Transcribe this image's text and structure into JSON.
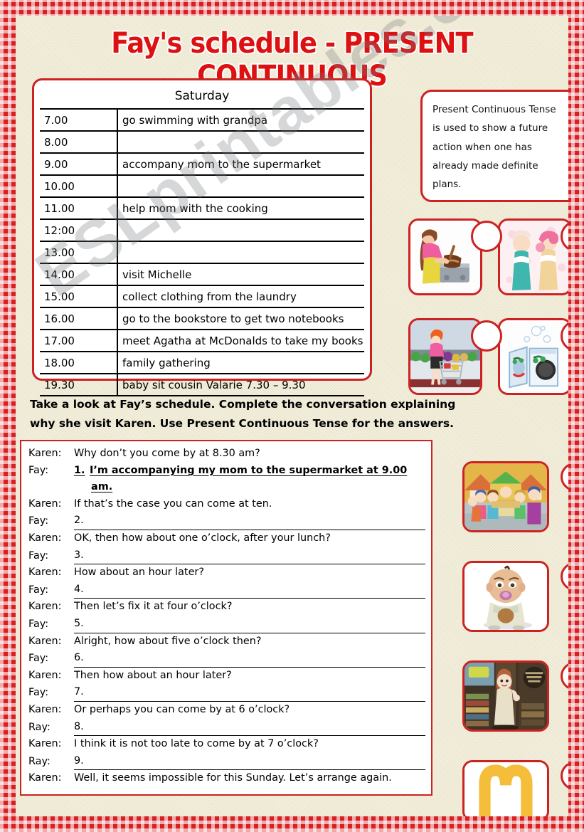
{
  "title": "Fay's schedule - PRESENT CONTINUOUS",
  "watermark": "ESLprintables.com",
  "colors": {
    "frame_red": "#cc2222",
    "title_red": "#dd1111",
    "gingham_red": "#d81f22",
    "paper": "#f4f1df"
  },
  "schedule": {
    "day_header": "Saturday",
    "rows": [
      {
        "time": "7.00",
        "activity": "go swimming with grandpa"
      },
      {
        "time": "8.00",
        "activity": ""
      },
      {
        "time": "9.00",
        "activity": "accompany mom to the supermarket"
      },
      {
        "time": "10.00",
        "activity": ""
      },
      {
        "time": "11.00",
        "activity": "help mom with the cooking"
      },
      {
        "time": "12:00",
        "activity": ""
      },
      {
        "time": "13.00",
        "activity": ""
      },
      {
        "time": "14.00",
        "activity": "visit Michelle"
      },
      {
        "time": "15.00",
        "activity": "collect clothing from the laundry"
      },
      {
        "time": "16.00",
        "activity": "go to the bookstore to get two notebooks"
      },
      {
        "time": "17.00",
        "activity": "meet Agatha at McDonalds to take my books"
      },
      {
        "time": "18.00",
        "activity": "family gathering"
      },
      {
        "time": "19.30",
        "activity": "baby sit cousin Valarie   7.30 – 9.30"
      }
    ]
  },
  "note": {
    "lines": [
      "Present Continuous Tense",
      "is used to show a future",
      "action when one has",
      "already made definite",
      "plans."
    ]
  },
  "pictures_top": [
    {
      "name": "cooking-picture",
      "caption": "woman cooking at stove"
    },
    {
      "name": "friends-picture",
      "caption": "two girls talking"
    },
    {
      "name": "supermarket-picture",
      "caption": "woman pushing shopping cart"
    },
    {
      "name": "laundry-picture",
      "caption": "smiling washing machines"
    }
  ],
  "pictures_bottom": [
    {
      "name": "family-gathering-picture",
      "caption": "children around a table"
    },
    {
      "name": "baby-picture",
      "caption": "baby with pacifier"
    },
    {
      "name": "bookstore-picture",
      "caption": "girl in a bookstore"
    },
    {
      "name": "mcdonalds-picture",
      "caption": "McDonalds golden arches logo"
    }
  ],
  "instructions": {
    "line1": "Take a look at Fay’s schedule.   Complete the conversation explaining",
    "line2": "why she visit Karen.   Use Present Continuous Tense for the answers."
  },
  "dialogue": [
    {
      "speaker": "Karen:",
      "text": "Why don’t you come by at 8.30 am?",
      "type": "prompt"
    },
    {
      "speaker": "Fay:",
      "number": "1.",
      "text": "I’m accompanying my mom to the supermarket at 9.00",
      "continuation": "am.",
      "type": "filled"
    },
    {
      "speaker": "Karen:",
      "text": "If that’s the case you can come at ten.",
      "type": "prompt"
    },
    {
      "speaker": "Fay:",
      "number": "2.",
      "text": "",
      "type": "answer"
    },
    {
      "speaker": "Karen:",
      "text": "OK, then how about one o’clock, after your lunch?",
      "type": "prompt"
    },
    {
      "speaker": "Fay:",
      "number": "3.",
      "text": "",
      "type": "answer"
    },
    {
      "speaker": "Karen:",
      "text": "How about an hour later?",
      "type": "prompt"
    },
    {
      "speaker": "Fay:",
      "number": "4.",
      "text": "",
      "type": "answer"
    },
    {
      "speaker": "Karen:",
      "text": "Then let’s fix it at four o’clock?",
      "type": "prompt"
    },
    {
      "speaker": "Fay:",
      "number": "5.",
      "text": "",
      "type": "answer"
    },
    {
      "speaker": "Karen:",
      "text": "Alright, how about five o’clock then?",
      "type": "prompt"
    },
    {
      "speaker": "Fay:",
      "number": "6.",
      "text": "",
      "type": "answer"
    },
    {
      "speaker": "Karen:",
      "text": "Then how about an hour later?",
      "type": "prompt"
    },
    {
      "speaker": "Fay:",
      "number": "7.",
      "text": "",
      "type": "answer"
    },
    {
      "speaker": "Karen:",
      "text": "Or perhaps you can come by at 6 o’clock?",
      "type": "prompt"
    },
    {
      "speaker": "Ray:",
      "number": "8.",
      "text": "",
      "type": "answer"
    },
    {
      "speaker": "Karen:",
      "text": "I think it is not too late to come by at 7 o’clock?",
      "type": "prompt"
    },
    {
      "speaker": "Ray:",
      "number": "9.",
      "text": "",
      "type": "answer"
    },
    {
      "speaker": "Karen:",
      "text": "Well, it seems impossible for this Sunday.   Let’s arrange again.",
      "type": "prompt"
    }
  ]
}
